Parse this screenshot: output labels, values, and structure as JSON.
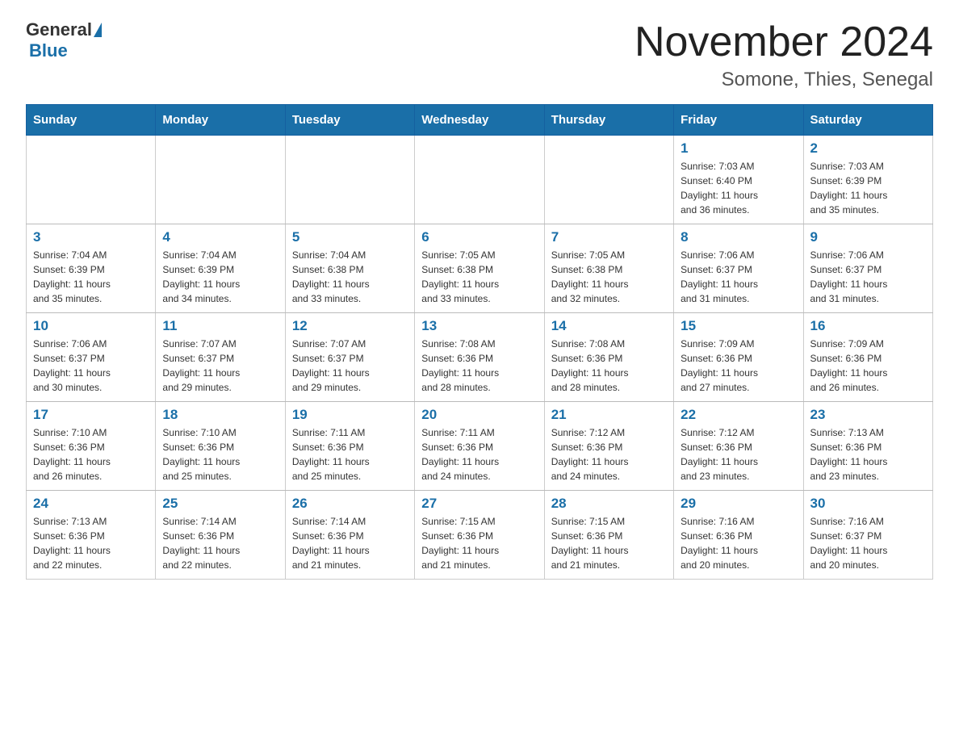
{
  "header": {
    "logo_general": "General",
    "logo_blue": "Blue",
    "month_title": "November 2024",
    "location": "Somone, Thies, Senegal"
  },
  "days_of_week": [
    "Sunday",
    "Monday",
    "Tuesday",
    "Wednesday",
    "Thursday",
    "Friday",
    "Saturday"
  ],
  "weeks": [
    [
      {
        "day": "",
        "info": ""
      },
      {
        "day": "",
        "info": ""
      },
      {
        "day": "",
        "info": ""
      },
      {
        "day": "",
        "info": ""
      },
      {
        "day": "",
        "info": ""
      },
      {
        "day": "1",
        "info": "Sunrise: 7:03 AM\nSunset: 6:40 PM\nDaylight: 11 hours\nand 36 minutes."
      },
      {
        "day": "2",
        "info": "Sunrise: 7:03 AM\nSunset: 6:39 PM\nDaylight: 11 hours\nand 35 minutes."
      }
    ],
    [
      {
        "day": "3",
        "info": "Sunrise: 7:04 AM\nSunset: 6:39 PM\nDaylight: 11 hours\nand 35 minutes."
      },
      {
        "day": "4",
        "info": "Sunrise: 7:04 AM\nSunset: 6:39 PM\nDaylight: 11 hours\nand 34 minutes."
      },
      {
        "day": "5",
        "info": "Sunrise: 7:04 AM\nSunset: 6:38 PM\nDaylight: 11 hours\nand 33 minutes."
      },
      {
        "day": "6",
        "info": "Sunrise: 7:05 AM\nSunset: 6:38 PM\nDaylight: 11 hours\nand 33 minutes."
      },
      {
        "day": "7",
        "info": "Sunrise: 7:05 AM\nSunset: 6:38 PM\nDaylight: 11 hours\nand 32 minutes."
      },
      {
        "day": "8",
        "info": "Sunrise: 7:06 AM\nSunset: 6:37 PM\nDaylight: 11 hours\nand 31 minutes."
      },
      {
        "day": "9",
        "info": "Sunrise: 7:06 AM\nSunset: 6:37 PM\nDaylight: 11 hours\nand 31 minutes."
      }
    ],
    [
      {
        "day": "10",
        "info": "Sunrise: 7:06 AM\nSunset: 6:37 PM\nDaylight: 11 hours\nand 30 minutes."
      },
      {
        "day": "11",
        "info": "Sunrise: 7:07 AM\nSunset: 6:37 PM\nDaylight: 11 hours\nand 29 minutes."
      },
      {
        "day": "12",
        "info": "Sunrise: 7:07 AM\nSunset: 6:37 PM\nDaylight: 11 hours\nand 29 minutes."
      },
      {
        "day": "13",
        "info": "Sunrise: 7:08 AM\nSunset: 6:36 PM\nDaylight: 11 hours\nand 28 minutes."
      },
      {
        "day": "14",
        "info": "Sunrise: 7:08 AM\nSunset: 6:36 PM\nDaylight: 11 hours\nand 28 minutes."
      },
      {
        "day": "15",
        "info": "Sunrise: 7:09 AM\nSunset: 6:36 PM\nDaylight: 11 hours\nand 27 minutes."
      },
      {
        "day": "16",
        "info": "Sunrise: 7:09 AM\nSunset: 6:36 PM\nDaylight: 11 hours\nand 26 minutes."
      }
    ],
    [
      {
        "day": "17",
        "info": "Sunrise: 7:10 AM\nSunset: 6:36 PM\nDaylight: 11 hours\nand 26 minutes."
      },
      {
        "day": "18",
        "info": "Sunrise: 7:10 AM\nSunset: 6:36 PM\nDaylight: 11 hours\nand 25 minutes."
      },
      {
        "day": "19",
        "info": "Sunrise: 7:11 AM\nSunset: 6:36 PM\nDaylight: 11 hours\nand 25 minutes."
      },
      {
        "day": "20",
        "info": "Sunrise: 7:11 AM\nSunset: 6:36 PM\nDaylight: 11 hours\nand 24 minutes."
      },
      {
        "day": "21",
        "info": "Sunrise: 7:12 AM\nSunset: 6:36 PM\nDaylight: 11 hours\nand 24 minutes."
      },
      {
        "day": "22",
        "info": "Sunrise: 7:12 AM\nSunset: 6:36 PM\nDaylight: 11 hours\nand 23 minutes."
      },
      {
        "day": "23",
        "info": "Sunrise: 7:13 AM\nSunset: 6:36 PM\nDaylight: 11 hours\nand 23 minutes."
      }
    ],
    [
      {
        "day": "24",
        "info": "Sunrise: 7:13 AM\nSunset: 6:36 PM\nDaylight: 11 hours\nand 22 minutes."
      },
      {
        "day": "25",
        "info": "Sunrise: 7:14 AM\nSunset: 6:36 PM\nDaylight: 11 hours\nand 22 minutes."
      },
      {
        "day": "26",
        "info": "Sunrise: 7:14 AM\nSunset: 6:36 PM\nDaylight: 11 hours\nand 21 minutes."
      },
      {
        "day": "27",
        "info": "Sunrise: 7:15 AM\nSunset: 6:36 PM\nDaylight: 11 hours\nand 21 minutes."
      },
      {
        "day": "28",
        "info": "Sunrise: 7:15 AM\nSunset: 6:36 PM\nDaylight: 11 hours\nand 21 minutes."
      },
      {
        "day": "29",
        "info": "Sunrise: 7:16 AM\nSunset: 6:36 PM\nDaylight: 11 hours\nand 20 minutes."
      },
      {
        "day": "30",
        "info": "Sunrise: 7:16 AM\nSunset: 6:37 PM\nDaylight: 11 hours\nand 20 minutes."
      }
    ]
  ]
}
